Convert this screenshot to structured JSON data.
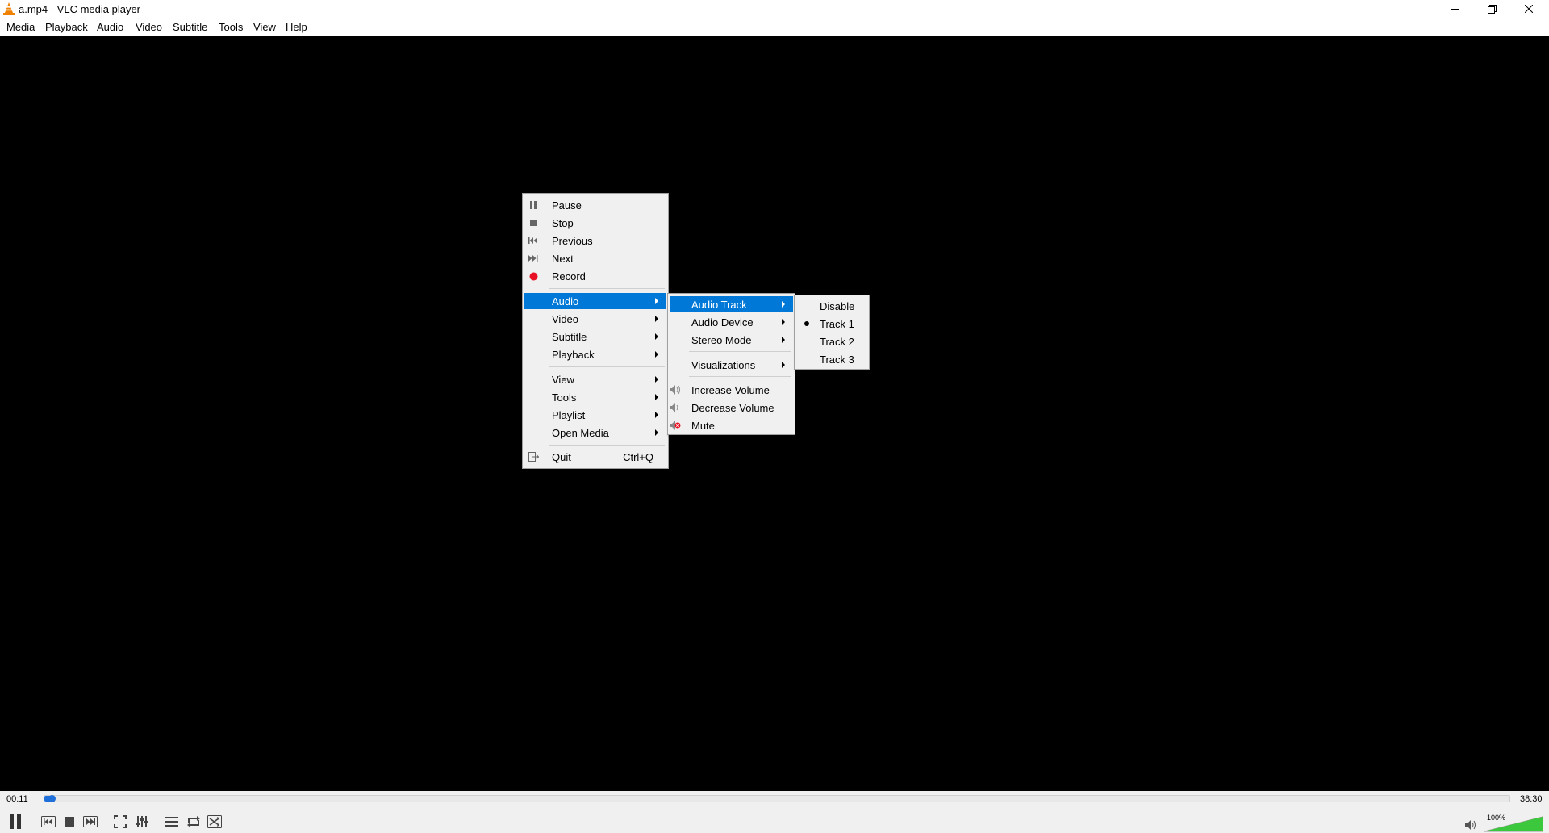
{
  "window": {
    "title": "a.mp4 - VLC media player",
    "controls": [
      "minimize-icon",
      "restore-icon",
      "close-icon"
    ]
  },
  "menubar": [
    "Media",
    "Playback",
    "Audio",
    "Video",
    "Subtitle",
    "Tools",
    "View",
    "Help"
  ],
  "context_menu": {
    "items": [
      {
        "label": "Pause",
        "icon": "pause-icon"
      },
      {
        "label": "Stop",
        "icon": "stop-icon"
      },
      {
        "label": "Previous",
        "icon": "previous-icon"
      },
      {
        "label": "Next",
        "icon": "next-icon"
      },
      {
        "label": "Record",
        "icon": "record-icon"
      },
      {
        "label": "Audio",
        "submenu": true,
        "highlighted": true
      },
      {
        "label": "Video",
        "submenu": true
      },
      {
        "label": "Subtitle",
        "submenu": true
      },
      {
        "label": "Playback",
        "submenu": true
      },
      {
        "label": "View",
        "submenu": true
      },
      {
        "label": "Tools",
        "submenu": true
      },
      {
        "label": "Playlist",
        "submenu": true
      },
      {
        "label": "Open Media",
        "submenu": true
      },
      {
        "label": "Quit",
        "shortcut": "Ctrl+Q",
        "icon": "quit-icon"
      }
    ]
  },
  "audio_menu": {
    "items": [
      {
        "label": "Audio Track",
        "submenu": true,
        "highlighted": true
      },
      {
        "label": "Audio Device",
        "submenu": true
      },
      {
        "label": "Stereo Mode",
        "submenu": true
      },
      {
        "label": "Visualizations",
        "submenu": true
      },
      {
        "label": "Increase Volume",
        "icon": "volume-up-icon"
      },
      {
        "label": "Decrease Volume",
        "icon": "volume-down-icon"
      },
      {
        "label": "Mute",
        "icon": "mute-icon"
      }
    ]
  },
  "audio_track_menu": {
    "items": [
      {
        "label": "Disable"
      },
      {
        "label": "Track 1",
        "selected": true
      },
      {
        "label": "Track 2"
      },
      {
        "label": "Track 3"
      }
    ]
  },
  "playback": {
    "elapsed": "00:11",
    "total": "38:30",
    "progress_fraction": 0.005
  },
  "volume": {
    "label": "100%",
    "level_fraction": 1.0
  },
  "colors": {
    "highlight": "#0078d7",
    "record": "#e81123",
    "seek": "#1e6fd9",
    "volume": "#3cc83c",
    "vlc_orange": "#f08000"
  }
}
